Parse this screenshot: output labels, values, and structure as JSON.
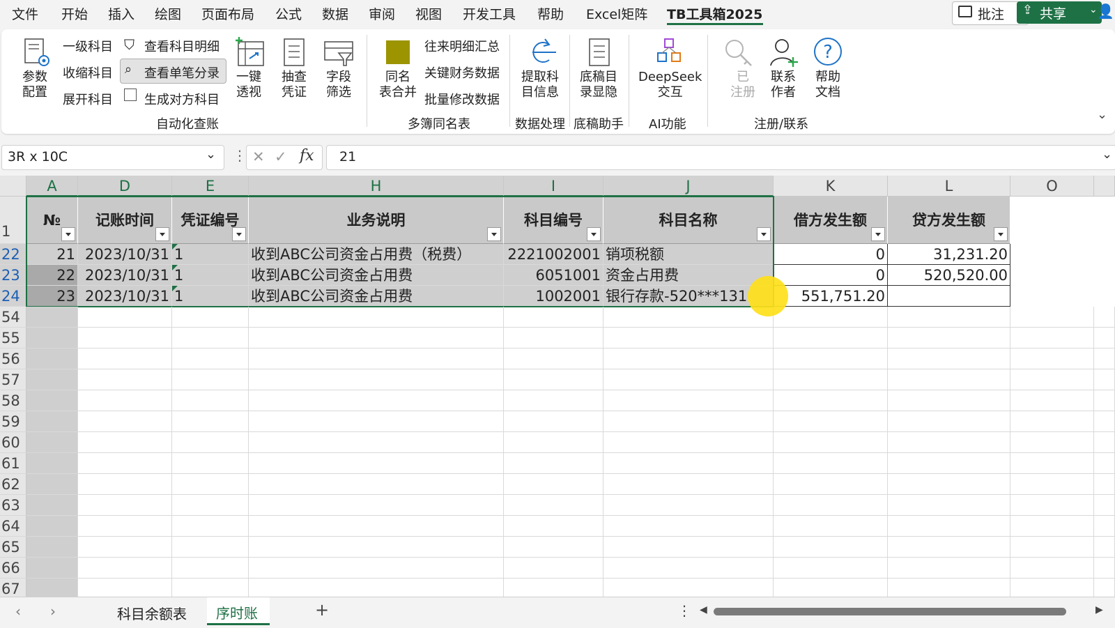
{
  "menu": {
    "items": [
      "文件",
      "开始",
      "插入",
      "绘图",
      "页面布局",
      "公式",
      "数据",
      "审阅",
      "视图",
      "开发工具",
      "帮助",
      "Excel矩阵",
      "TB工具箱2025"
    ],
    "active": "TB工具箱2025",
    "comment_label": "批注",
    "share_label": "共享"
  },
  "ribbon": {
    "param": "参数\n配置",
    "level1": "一级科目",
    "collapse": "收缩科目",
    "expand": "展开科目",
    "view_detail": "查看科目明细",
    "view_entry": "查看单笔分录",
    "gen_opposite": "生成对方科目",
    "pivot": "一键\n透视",
    "sample": "抽查\n凭证",
    "filter": "字段\n筛选",
    "group_auto": "自动化查账",
    "merge_same": "同名\n表合并",
    "acct_summary": "往来明细汇总",
    "key_fin": "关键财务数据",
    "batch_mod": "批量修改数据",
    "group_multi": "多簿同名表",
    "extract": "提取科\n目信息",
    "group_data": "数据处理",
    "dir_hide": "底稿目\n录显隐",
    "group_draft": "底稿助手",
    "deepseek": "DeepSeek\n交互",
    "group_ai": "AI功能",
    "registered": "已\n注册",
    "contact": "联系\n作者",
    "help": "帮助\n文档",
    "group_reg": "注册/联系"
  },
  "formula_bar": {
    "name_box": "3R x 10C",
    "formula": "21"
  },
  "columns": [
    "A",
    "D",
    "E",
    "H",
    "I",
    "J",
    "K",
    "L",
    "O"
  ],
  "header_row": {
    "row_no": "1",
    "cells": [
      "№",
      "记账时间",
      "凭证编号",
      "业务说明",
      "科目编号",
      "科目名称",
      "借方发生额",
      "贷方发生额"
    ]
  },
  "rows": [
    {
      "row": "22",
      "no": "21",
      "date": "2023/10/31",
      "voucher": "1",
      "desc": "收到ABC公司资金占用费（税费）",
      "code": "2221002001",
      "name": "销项税额",
      "debit": "0",
      "credit": "31,231.20"
    },
    {
      "row": "23",
      "no": "22",
      "date": "2023/10/31",
      "voucher": "1",
      "desc": "收到ABC公司资金占用费",
      "code": "6051001",
      "name": "资金占用费",
      "debit": "0",
      "credit": "520,520.00"
    },
    {
      "row": "24",
      "no": "23",
      "date": "2023/10/31",
      "voucher": "1",
      "desc": "收到ABC公司资金占用费",
      "code": "1002001",
      "name": "银行存款-520***131",
      "debit": "551,751.20",
      "credit": ""
    }
  ],
  "empty_rows": [
    "54",
    "55",
    "56",
    "57",
    "58",
    "59",
    "60",
    "61",
    "62",
    "63",
    "64",
    "65",
    "66",
    "67"
  ],
  "sheets": {
    "tab1": "科目余额表",
    "tab2": "序时账",
    "add": "+"
  },
  "colors": {
    "accent": "#1e7145",
    "cursor_dot": "#ffe01a",
    "merge_icon": "#9c9400"
  }
}
